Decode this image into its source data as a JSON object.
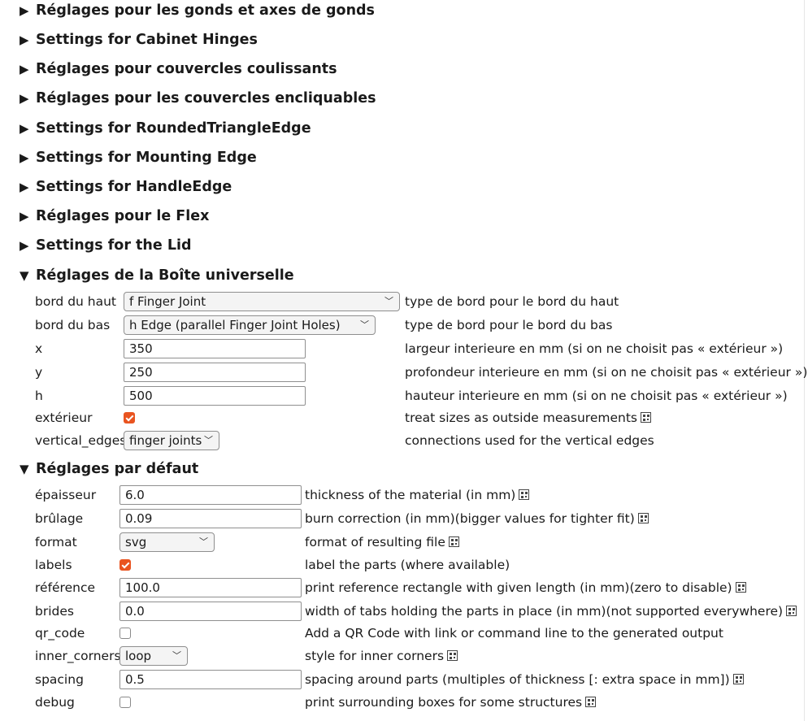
{
  "collapsed_sections": [
    "Réglages pour les gonds et axes de gonds",
    "Settings for Cabinet Hinges",
    "Réglages pour couvercles coulissants",
    "Réglages pour les couvercles encliquables",
    "Settings for RoundedTriangleEdge",
    "Settings for Mounting Edge",
    "Settings for HandleEdge",
    "Réglages pour le Flex",
    "Settings for the Lid"
  ],
  "arrows": {
    "collapsed": "▶",
    "expanded": "▼"
  },
  "universal_box": {
    "title": "Réglages de la Boîte universelle",
    "bord_du_haut": {
      "label": "bord du haut",
      "value": "f Finger Joint",
      "desc": "type de bord pour le bord du haut"
    },
    "bord_du_bas": {
      "label": "bord du bas",
      "value": "h Edge (parallel Finger Joint Holes)",
      "desc": "type de bord pour le bord du bas"
    },
    "x": {
      "label": "x",
      "value": "350",
      "desc": "largeur interieure en mm (si on ne choisit pas « extérieur »)"
    },
    "y": {
      "label": "y",
      "value": "250",
      "desc": "profondeur interieure en mm (si on ne choisit pas « extérieur »)"
    },
    "h": {
      "label": "h",
      "value": "500",
      "desc": "hauteur interieure en mm (si on ne choisit pas « extérieur »)"
    },
    "exterieur": {
      "label": "extérieur",
      "checked": true,
      "desc": "treat sizes as outside measurements"
    },
    "vertical_edges": {
      "label": "vertical_edges",
      "value": "finger joints",
      "desc": "connections used for the vertical edges"
    }
  },
  "defaults": {
    "title": "Réglages par défaut",
    "epaisseur": {
      "label": "épaisseur",
      "value": "6.0",
      "desc": "thickness of the material (in mm)"
    },
    "brulage": {
      "label": "brûlage",
      "value": "0.09",
      "desc": "burn correction (in mm)(bigger values for tighter fit)"
    },
    "format": {
      "label": "format",
      "value": "svg",
      "desc": "format of resulting file"
    },
    "labels": {
      "label": "labels",
      "checked": true,
      "desc": "label the parts (where available)"
    },
    "reference": {
      "label": "référence",
      "value": "100.0",
      "desc": "print reference rectangle with given length (in mm)(zero to disable)"
    },
    "brides": {
      "label": "brides",
      "value": "0.0",
      "desc": "width of tabs holding the parts in place (in mm)(not supported everywhere)"
    },
    "qr_code": {
      "label": "qr_code",
      "checked": false,
      "desc": "Add a QR Code with link or command line to the generated output"
    },
    "inner_corners": {
      "label": "inner_corners",
      "value": "loop",
      "desc": "style for inner corners"
    },
    "spacing": {
      "label": "spacing",
      "value": "0.5",
      "desc": "spacing around parts (multiples of thickness [: extra space in mm])"
    },
    "debug": {
      "label": "debug",
      "checked": false,
      "desc": "print surrounding boxes for some structures"
    }
  },
  "colors": {
    "checkbox_accent": "#e95420"
  }
}
